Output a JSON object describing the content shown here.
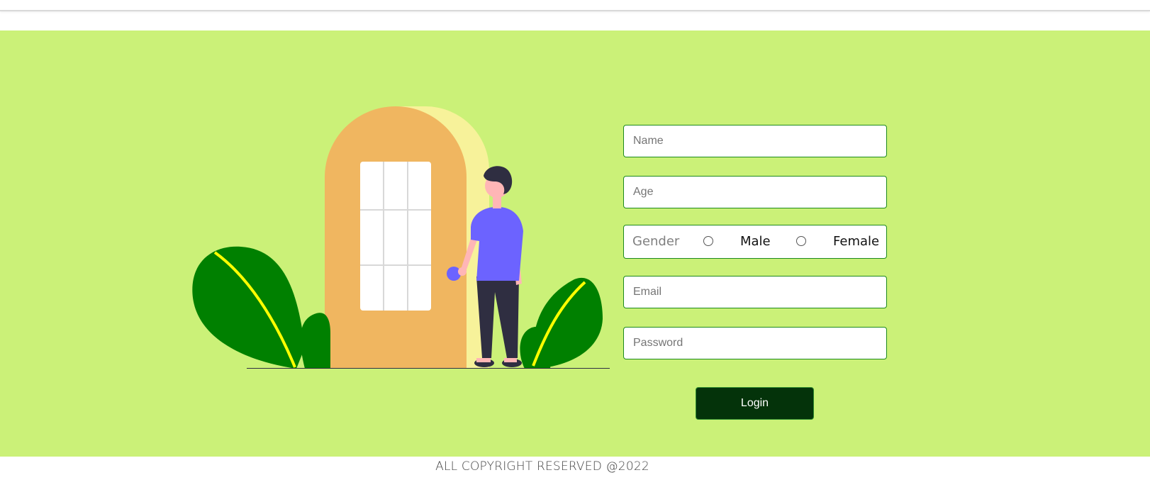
{
  "form": {
    "name_placeholder": "Name",
    "age_placeholder": "Age",
    "gender_label": "Gender",
    "gender_options": [
      "Male",
      "Female"
    ],
    "email_placeholder": "Email",
    "password_placeholder": "Password",
    "login_label": "Login"
  },
  "footer": {
    "text": "ALL COPYRIGHT RESERVED @2022"
  },
  "colors": {
    "hero_background": "#cbf178",
    "button_background": "#04330a",
    "field_border": "#1d8a1d",
    "door": "#f0b660",
    "door_back": "#f7f29a",
    "leaf": "#008000",
    "leaf_vein": "#ffff00",
    "shirt": "#6c63ff",
    "pants": "#2f2e41"
  },
  "icons": {
    "illustration": "person-opening-door-illustration"
  }
}
